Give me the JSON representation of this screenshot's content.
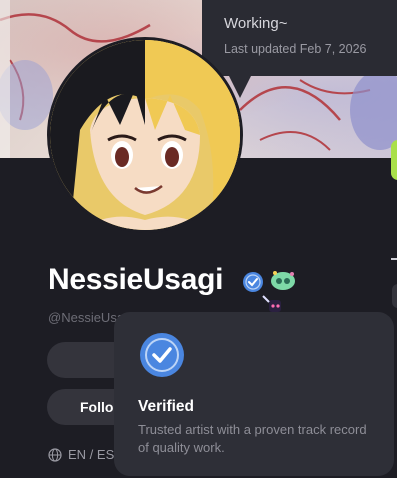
{
  "status_tooltip": {
    "status": "Working~",
    "updated": "Last updated Feb 7, 2026"
  },
  "profile": {
    "username": "NessieUsagi",
    "handle": "@NessieUsa",
    "follow_label": "Follo",
    "languages": "EN / ES"
  },
  "verified_popover": {
    "title": "Verified",
    "description": "Trusted artist with a proven track record of quality work."
  },
  "colors": {
    "background": "#1d1d24",
    "verified_blue": "#4a86e0",
    "popover": "#2e2f37"
  }
}
